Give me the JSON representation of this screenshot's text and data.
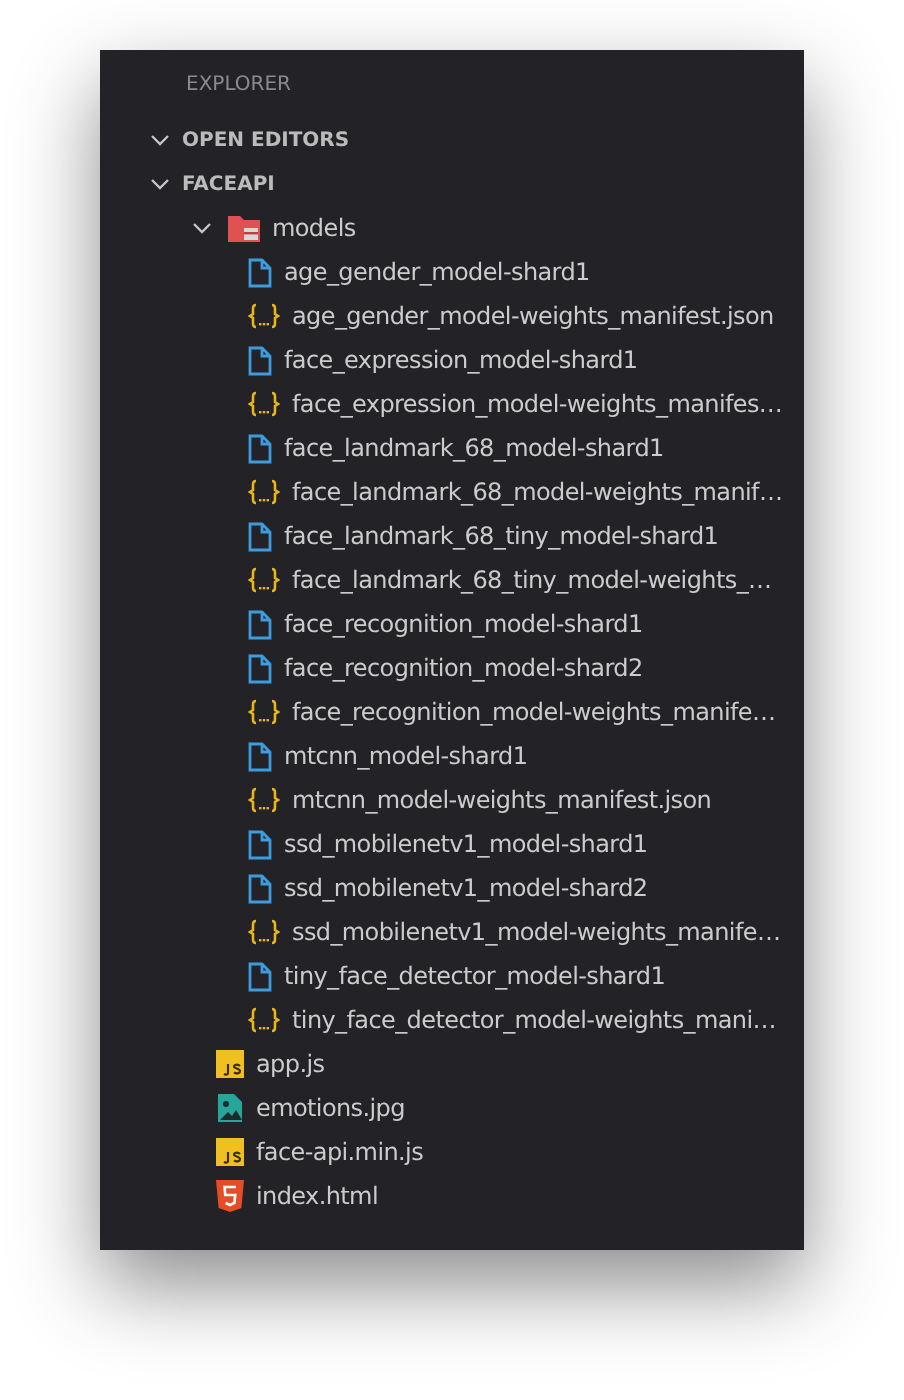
{
  "title": "EXPLORER",
  "sections": [
    {
      "label": "OPEN EDITORS",
      "expanded": true
    },
    {
      "label": "FACEAPI",
      "expanded": true,
      "children": [
        {
          "name": "models",
          "kind": "folder",
          "expanded": true,
          "children": [
            {
              "name": "age_gender_model-shard1",
              "kind": "file"
            },
            {
              "name": "age_gender_model-weights_manifest.json",
              "kind": "json"
            },
            {
              "name": "face_expression_model-shard1",
              "kind": "file"
            },
            {
              "name": "face_expression_model-weights_manifes…",
              "kind": "json"
            },
            {
              "name": "face_landmark_68_model-shard1",
              "kind": "file"
            },
            {
              "name": "face_landmark_68_model-weights_manif…",
              "kind": "json"
            },
            {
              "name": "face_landmark_68_tiny_model-shard1",
              "kind": "file"
            },
            {
              "name": "face_landmark_68_tiny_model-weights_…",
              "kind": "json"
            },
            {
              "name": "face_recognition_model-shard1",
              "kind": "file"
            },
            {
              "name": "face_recognition_model-shard2",
              "kind": "file"
            },
            {
              "name": "face_recognition_model-weights_manife…",
              "kind": "json"
            },
            {
              "name": "mtcnn_model-shard1",
              "kind": "file"
            },
            {
              "name": "mtcnn_model-weights_manifest.json",
              "kind": "json"
            },
            {
              "name": "ssd_mobilenetv1_model-shard1",
              "kind": "file"
            },
            {
              "name": "ssd_mobilenetv1_model-shard2",
              "kind": "file"
            },
            {
              "name": "ssd_mobilenetv1_model-weights_manife…",
              "kind": "json"
            },
            {
              "name": "tiny_face_detector_model-shard1",
              "kind": "file"
            },
            {
              "name": "tiny_face_detector_model-weights_mani…",
              "kind": "json"
            }
          ]
        },
        {
          "name": "app.js",
          "kind": "js"
        },
        {
          "name": "emotions.jpg",
          "kind": "image"
        },
        {
          "name": "face-api.min.js",
          "kind": "js"
        },
        {
          "name": "index.html",
          "kind": "html"
        }
      ]
    }
  ]
}
